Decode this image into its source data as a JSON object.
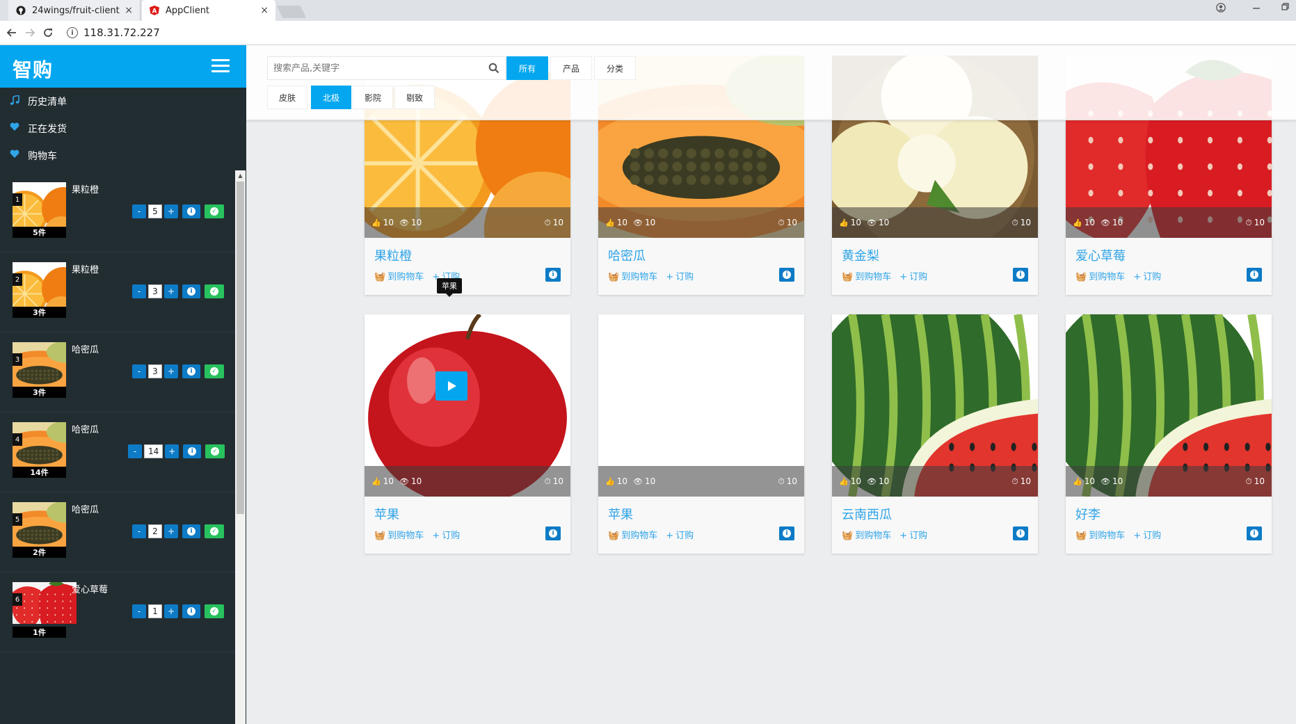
{
  "browser": {
    "tabs": [
      {
        "label": "24wings/fruit-client",
        "icon": "github-icon"
      },
      {
        "label": "AppClient",
        "icon": "angular-icon"
      }
    ],
    "tab_close": "×",
    "url": "118.31.72.227"
  },
  "app": {
    "brand": "智购"
  },
  "sidebar": {
    "nav": [
      {
        "label": "历史清单",
        "icon": "music-icon"
      },
      {
        "label": "正在发货",
        "icon": "heart-icon"
      },
      {
        "label": "购物车",
        "icon": "heart-icon"
      }
    ],
    "cart": [
      {
        "index": "1",
        "name": "果粒橙",
        "qty": "5",
        "tag": "5件",
        "fruit": "orange"
      },
      {
        "index": "2",
        "name": "果粒橙",
        "qty": "3",
        "tag": "3件",
        "fruit": "orange"
      },
      {
        "index": "3",
        "name": "哈密瓜",
        "qty": "3",
        "tag": "3件",
        "fruit": "papaya"
      },
      {
        "index": "4",
        "name": "哈密瓜",
        "qty": "14",
        "tag": "14件",
        "fruit": "papaya"
      },
      {
        "index": "5",
        "name": "哈密瓜",
        "qty": "2",
        "tag": "2件",
        "fruit": "papaya"
      },
      {
        "index": "6",
        "name": "爱心草莓",
        "qty": "1",
        "tag": "1件",
        "fruit": "strawberry"
      }
    ],
    "minus_label": "-",
    "plus_label": "+"
  },
  "filters": {
    "search_placeholder": "搜索产品,关键字",
    "row1": [
      "所有",
      "产品",
      "分类"
    ],
    "row1_active": 0,
    "row2": [
      "皮肤",
      "北极",
      "影院",
      "剔致"
    ],
    "row2_active": 1
  },
  "products": [
    {
      "name": "果粒橙",
      "likes": "10",
      "views": "10",
      "time": "10",
      "fruit": "orange"
    },
    {
      "name": "哈密瓜",
      "likes": "10",
      "views": "10",
      "time": "10",
      "fruit": "papaya"
    },
    {
      "name": "黄金梨",
      "likes": "10",
      "views": "10",
      "time": "10",
      "fruit": "pear"
    },
    {
      "name": "爱心草莓",
      "likes": "10",
      "views": "10",
      "time": "10",
      "fruit": "strawberry"
    },
    {
      "name": "苹果",
      "likes": "10",
      "views": "10",
      "time": "10",
      "fruit": "apple"
    },
    {
      "name": "苹果",
      "likes": "10",
      "views": "10",
      "time": "10",
      "fruit": "blank"
    },
    {
      "name": "云南西瓜",
      "likes": "10",
      "views": "10",
      "time": "10",
      "fruit": "watermelon"
    },
    {
      "name": "好李",
      "likes": "10",
      "views": "10",
      "time": "10",
      "fruit": "watermelon"
    }
  ],
  "card_actions": {
    "cart": "到购物车",
    "order": "订购"
  },
  "tooltip": "苹果",
  "colors": {
    "accent": "#04a7ef",
    "sidebar": "#222d32",
    "success": "#27c25e",
    "info": "#0d7bc6"
  }
}
